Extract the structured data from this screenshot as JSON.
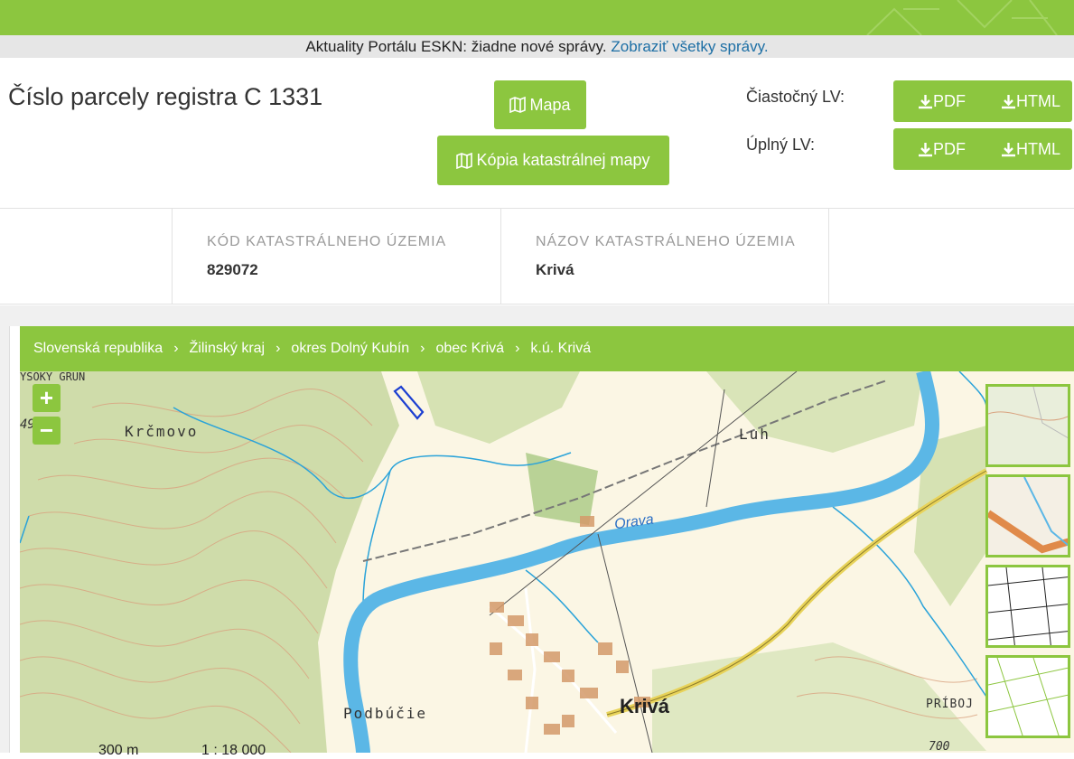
{
  "news": {
    "text": "Aktuality Portálu ESKN: žiadne nové správy.",
    "link": "Zobraziť všetky správy."
  },
  "parcel": {
    "title": "Číslo parcely registra C 1331"
  },
  "buttons": {
    "map": "Mapa",
    "copy": "Kópia katastrálnej mapy"
  },
  "lv": {
    "partial_label": "Čiastočný LV:",
    "full_label": "Úplný LV:",
    "pdf": "PDF",
    "html": "HTML"
  },
  "info": {
    "code_label": "KÓD KATASTRÁLNEHO ÚZEMIA",
    "code_value": "829072",
    "name_label": "NÁZOV KATASTRÁLNEHO ÚZEMIA",
    "name_value": "Krivá"
  },
  "breadcrumb": [
    "Slovenská republika",
    "Žilinský kraj",
    "okres Dolný Kubín",
    "obec Krivá",
    "k.ú. Krivá"
  ],
  "map": {
    "labels": {
      "vysoky": "YSOKY GRUN",
      "krcmovo": "Krčmovo",
      "luh": "Luh",
      "orava": "Orava",
      "kriva": "Krivá",
      "podbucie": "Podbúčie",
      "priboj": "PRÍBOJ",
      "elev": "700",
      "elev2": "49"
    },
    "scale_m": "300 m",
    "scale_ratio": "1 : 18 000"
  },
  "colors": {
    "accent": "#8cc63f",
    "link": "#1d6fa5"
  }
}
